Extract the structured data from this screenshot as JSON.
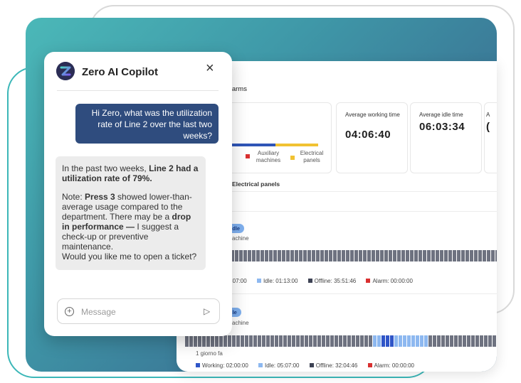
{
  "chat": {
    "title": "Zero AI Copilot",
    "close_icon": "×",
    "user_message": "Hi Zero, what was the utilization rate of Line 2 over the last two weeks?",
    "ai_p1_a": "In the past two weeks, ",
    "ai_p1_b": "Line 2 had a utilization rate of 79%.",
    "ai_p2_a": "Note: ",
    "ai_p2_b": "Press 3",
    "ai_p2_c": " showed lower-than-average usage compared to the department. There may be a ",
    "ai_p2_d": "drop in performance —",
    "ai_p2_e": " I suggest a check-up or preventive maintenance.",
    "ai_p2_f": "Would you like me to open a ticket?",
    "input_placeholder": "Message",
    "add_icon": "+",
    "send_icon": "▷"
  },
  "dashboard": {
    "section_title": "d Alarms",
    "kpi1_label": "s",
    "legend_aux": "Auxiliary machines",
    "legend_elec": "Electrical panels",
    "kpi2_label": "Average working time",
    "kpi2_value": "04:06:40",
    "kpi3_label": "Average idle time",
    "kpi3_value": "06:03:34",
    "kpi4_label": "A",
    "kpi4_value": "(",
    "sub_heading": "Electrical panels",
    "row1": {
      "badge": "i  Idle",
      "machine": "achine",
      "working": "2:07:00",
      "idle": "Idle: 01:13:00",
      "offline": "Offline: 35:51:46",
      "alarm": "Alarm: 00:00:00"
    },
    "row2": {
      "badge": "dle",
      "machine": "achine",
      "ago": "1 giorno fa",
      "working": "Working: 02:00:00",
      "idle": "Idle: 05:07:00",
      "offline": "Offline: 32:04:46",
      "alarm": "Alarm: 00:00:00"
    }
  },
  "colors": {
    "working": "#2f55c8",
    "idle": "#8db8f0",
    "offline": "#3d4254",
    "alarm": "#d93030",
    "auxiliary": "#d93030",
    "electrical": "#f1c232",
    "user_bubble": "#2f4c7e"
  }
}
